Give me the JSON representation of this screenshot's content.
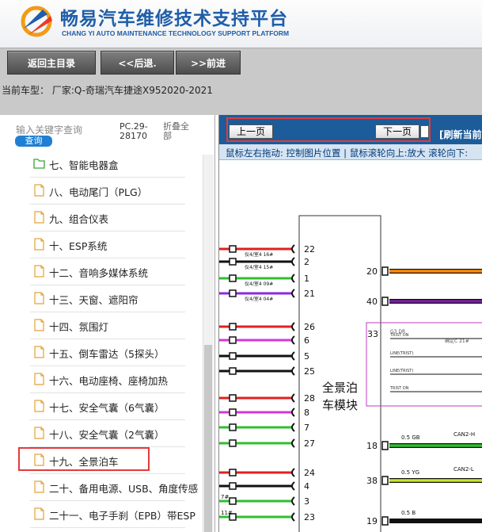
{
  "header": {
    "title_cn": "畅易汽车维修技术支持平台",
    "title_en": "CHANG YI AUTO MAINTENANCE TECHNOLOGY SUPPORT PLATFORM",
    "logo_icon": "cy-logo-icon"
  },
  "toolbar": {
    "home_label": "返回主目录",
    "back_label": "<<后退.",
    "forward_label": ">>前进"
  },
  "car_info": "当前车型： 厂家:Q-奇瑞汽车捷途X952020-2021",
  "sidebar": {
    "search_placeholder": "输入关键字查询",
    "search_button": "查询",
    "pc_code": "PC.29-28170",
    "collapse_all": "折叠全部",
    "items": [
      {
        "label": "七、智能电器盒",
        "icon": "folder-icon"
      },
      {
        "label": "八、电动尾门（PLG）",
        "icon": "document-icon"
      },
      {
        "label": "九、组合仪表",
        "icon": "document-icon"
      },
      {
        "label": "十、ESP系统",
        "icon": "document-icon"
      },
      {
        "label": "十二、音响多媒体系统",
        "icon": "document-icon"
      },
      {
        "label": "十三、天窗、遮阳帘",
        "icon": "document-icon"
      },
      {
        "label": "十四、氛围灯",
        "icon": "document-icon"
      },
      {
        "label": "十五、倒车雷达（5探头）",
        "icon": "document-icon"
      },
      {
        "label": "十六、电动座椅、座椅加热",
        "icon": "document-icon"
      },
      {
        "label": "十七、安全气囊（6气囊）",
        "icon": "document-icon"
      },
      {
        "label": "十八、安全气囊（2气囊）",
        "icon": "document-icon"
      },
      {
        "label": "十九、全景泊车",
        "icon": "document-icon"
      },
      {
        "label": "二十、备用电源、USB、角度传感",
        "icon": "document-icon"
      },
      {
        "label": "二十一、电子手刹（EPB）带ESP",
        "icon": "document-icon"
      }
    ]
  },
  "viewer": {
    "prev_page": "上一页",
    "next_page": "下一页",
    "refresh": "[刷新当前",
    "tip": "鼠标左右拖动: 控制图片位置 | 鼠标滚轮向上:放大  滚轮向下:",
    "diagram": {
      "module_label_1": "全景泊",
      "module_label_2": "车模块",
      "box_pin": "33",
      "box_label_1": "G3 DR",
      "box_label_2": "确定C 21#",
      "box_rows": [
        "TRIST DN",
        "LINE(TRIST)",
        "LINE(TRIST)",
        "TRIST DN"
      ],
      "left_pins": [
        "22",
        "2",
        "1",
        "21",
        "26",
        "6",
        "5",
        "25",
        "28",
        "8",
        "7",
        "27",
        "24",
        "4",
        "3",
        "23"
      ],
      "left_wire_labels": [
        "仪4/室4 16#",
        "仪4/室4 15#",
        "仪4/室4 09#",
        "仪4/室4 04#"
      ],
      "left_wire_colors": [
        "#e02020",
        "#111111",
        "#2fbf2f",
        "#8a2be2",
        "#e02020",
        "#d437d4",
        "#111111",
        "#111111",
        "#e02020",
        "#d437d4",
        "#2fbf2f",
        "#2fbf2f",
        "#e02020",
        "#111111",
        "#2fbf2f",
        "#2fbf2f"
      ],
      "left_pin_labels": [
        "",
        "",
        "",
        "",
        "",
        "",
        "",
        "",
        "",
        "",
        "",
        "",
        "",
        "",
        "7#",
        "11#"
      ],
      "right_pins": [
        {
          "pin": "20",
          "color": "#ff8c00"
        },
        {
          "pin": "40",
          "color": "#7a1fa2"
        },
        {
          "pin": "18",
          "color": "#2fbf2f",
          "wire": "0.5 GB",
          "signal": "CAN2-H"
        },
        {
          "pin": "38",
          "color": "#c8e62a",
          "wire": "0.5 YG",
          "signal": "CAN2-L"
        },
        {
          "pin": "19",
          "color": "#111111",
          "wire": "0.5 B"
        }
      ]
    }
  }
}
